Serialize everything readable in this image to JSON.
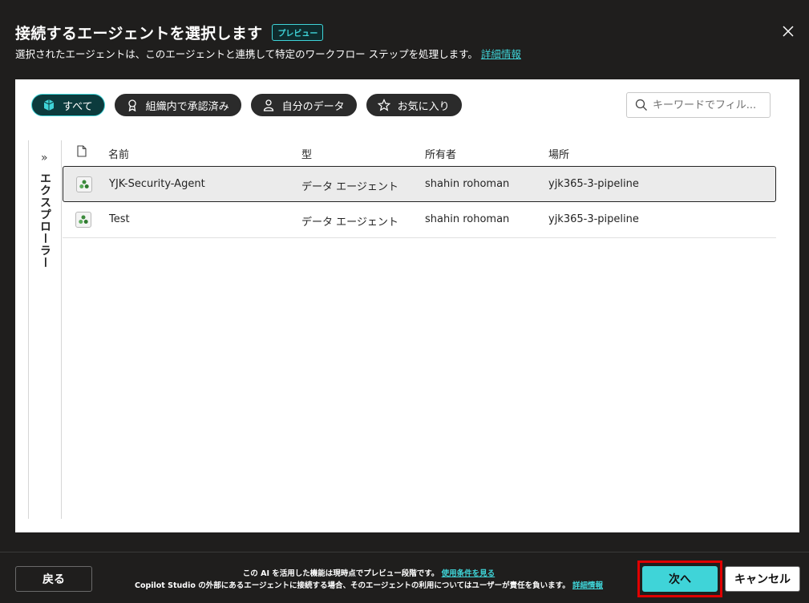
{
  "dialog": {
    "title": "接続するエージェントを選択します",
    "badge": "プレビュー",
    "subtitle": "選択されたエージェントは、このエージェントと連携して特定のワークフロー ステップを処理します。",
    "subtitle_link": "詳細情報"
  },
  "filters": [
    {
      "label": "すべて",
      "icon": "cube-icon",
      "active": true
    },
    {
      "label": "組織内で承認済み",
      "icon": "ribbon-icon",
      "active": false
    },
    {
      "label": "自分のデータ",
      "icon": "person-icon",
      "active": false
    },
    {
      "label": "お気に入り",
      "icon": "star-icon",
      "active": false
    }
  ],
  "search": {
    "placeholder": "キーワードでフィル..."
  },
  "explorer": {
    "label": "エクスプローラー"
  },
  "table": {
    "columns": [
      "名前",
      "型",
      "所有者",
      "場所"
    ],
    "rows": [
      {
        "name": "YJK-Security-Agent",
        "type": "データ エージェント",
        "owner": "shahin rohoman",
        "location": "yjk365-3-pipeline",
        "selected": true
      },
      {
        "name": "Test",
        "type": "データ エージェント",
        "owner": "shahin rohoman",
        "location": "yjk365-3-pipeline",
        "selected": false
      }
    ]
  },
  "footer": {
    "back_label": "戻る",
    "disclaimer_line1": "この AI を活用した機能は現時点でプレビュー段階です。",
    "disclaimer_link1": "使用条件を見る",
    "disclaimer_line2": "Copilot Studio の外部にあるエージェントに接続する場合、そのエージェントの利用についてはユーザーが責任を負います。",
    "disclaimer_link2": "詳細情報",
    "next_label": "次へ",
    "cancel_label": "キャンセル"
  },
  "colors": {
    "accent": "#3fd4d8",
    "highlight_border": "#e00000",
    "background": "#1f1e1d"
  }
}
